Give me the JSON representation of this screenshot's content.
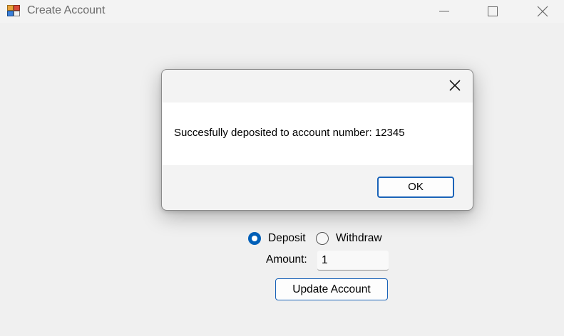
{
  "window": {
    "title": "Create Account",
    "icon": "forms-app-icon"
  },
  "dialog": {
    "message": "Succesfully deposited to account number: 12345",
    "ok_label": "OK"
  },
  "form": {
    "deposit_label": "Deposit",
    "withdraw_label": "Withdraw",
    "selected": "Deposit",
    "amount_label": "Amount:",
    "amount_value": "1",
    "update_label": "Update Account"
  },
  "colors": {
    "accent": "#005fb8",
    "button_border": "#1a63b8",
    "background": "#f0f0f0"
  }
}
